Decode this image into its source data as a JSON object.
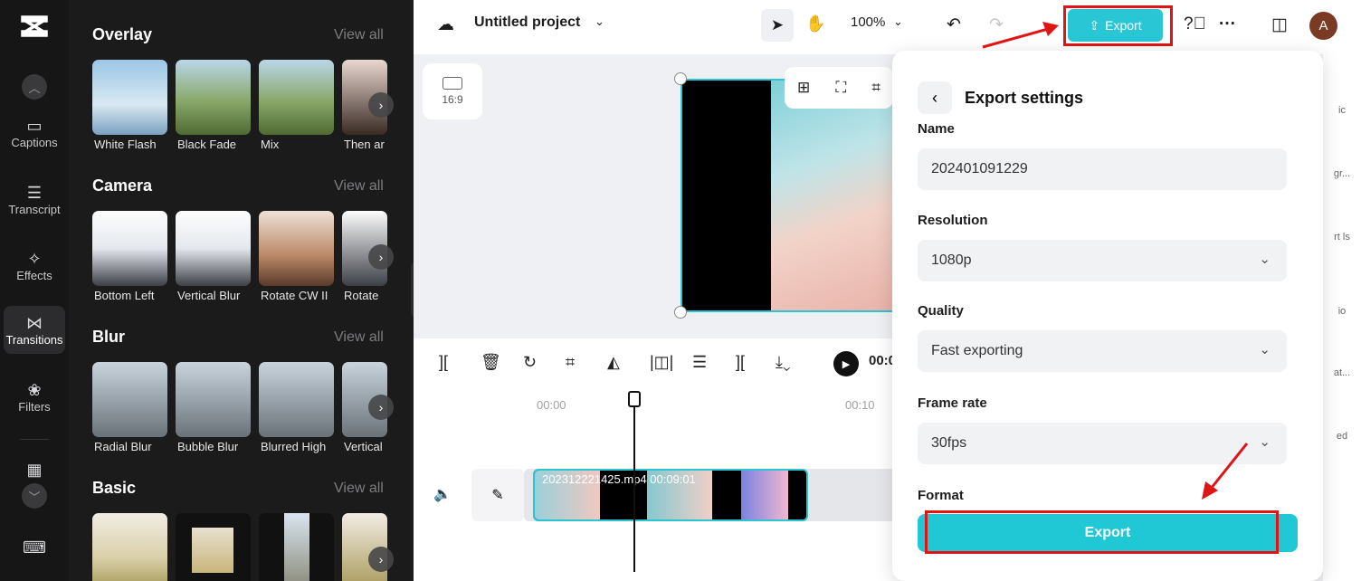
{
  "rail": {
    "items": [
      {
        "label": "Captions",
        "icon": "captions-icon"
      },
      {
        "label": "Transcript",
        "icon": "transcript-icon"
      },
      {
        "label": "Effects",
        "icon": "effects-icon"
      },
      {
        "label": "Transitions",
        "icon": "transitions-icon"
      },
      {
        "label": "Filters",
        "icon": "filters-icon"
      }
    ]
  },
  "panel": {
    "view_all": "View all",
    "sections": [
      {
        "title": "Overlay",
        "items": [
          "White Flash",
          "Black Fade",
          "Mix",
          "Then ar"
        ]
      },
      {
        "title": "Camera",
        "items": [
          "Bottom Left",
          "Vertical Blur",
          "Rotate CW II",
          "Rotate"
        ]
      },
      {
        "title": "Blur",
        "items": [
          "Radial Blur",
          "Bubble Blur",
          "Blurred High",
          "Vertical"
        ]
      },
      {
        "title": "Basic",
        "items": []
      }
    ]
  },
  "topbar": {
    "project_name": "Untitled project",
    "zoom": "100%",
    "export_label": "Export",
    "avatar_letter": "A"
  },
  "canvas": {
    "ratio": "16:9"
  },
  "timeline": {
    "time_display": "00:0",
    "ticks": [
      "00:00",
      "00:10"
    ],
    "clip_label": "202312221425.mp4  00:09:01"
  },
  "export_dialog": {
    "title": "Export settings",
    "name_label": "Name",
    "name_value": "202401091229",
    "resolution_label": "Resolution",
    "resolution_value": "1080p",
    "quality_label": "Quality",
    "quality_value": "Fast exporting",
    "framerate_label": "Frame rate",
    "framerate_value": "30fps",
    "format_label": "Format",
    "export_button": "Export"
  },
  "right_sidebar": [
    "ic",
    "gr...",
    "rt ls",
    "io",
    "at...",
    "ed"
  ],
  "colors": {
    "accent": "#29c7d6",
    "highlight": "#e01414",
    "rail_bg": "#161617",
    "panel_bg": "#1b1b1c"
  }
}
